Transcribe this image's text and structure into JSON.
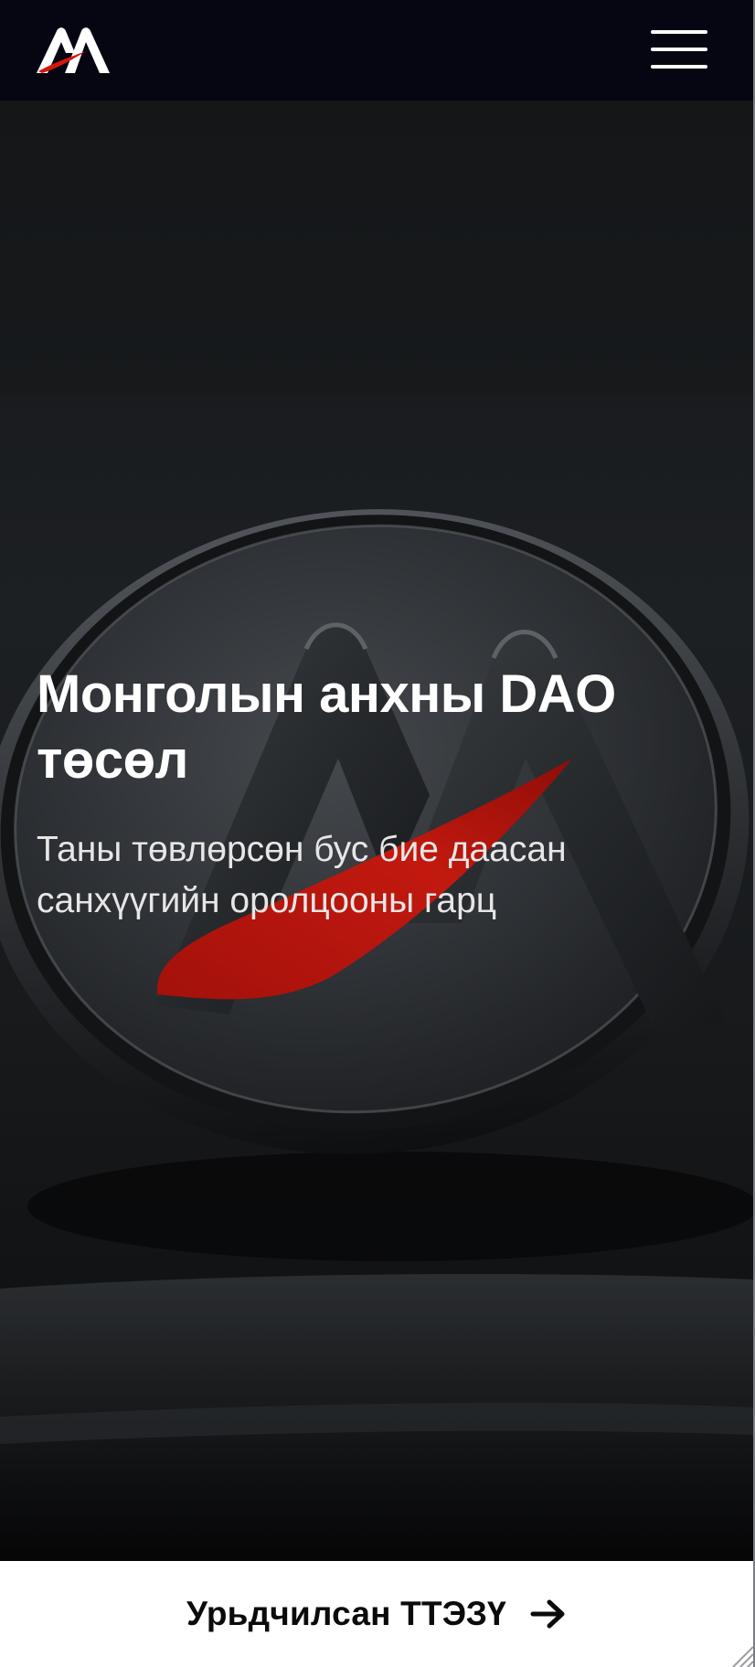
{
  "header": {
    "logo_icon": "brand-logo-icon",
    "menu_icon": "hamburger-menu-icon"
  },
  "hero": {
    "title": "Монголын анхны DAO төсөл",
    "subtitle": "Таны төвлөрсөн бус бие даасан санхүүгийн оролцооны гарц"
  },
  "cta": {
    "label": "Урьдчилсан ТТЭЗҮ",
    "icon": "arrow-right-icon"
  },
  "colors": {
    "header_bg": "#050611",
    "accent_red": "#c0170f",
    "cta_bg": "#ffffff",
    "text_light": "#ffffff"
  }
}
